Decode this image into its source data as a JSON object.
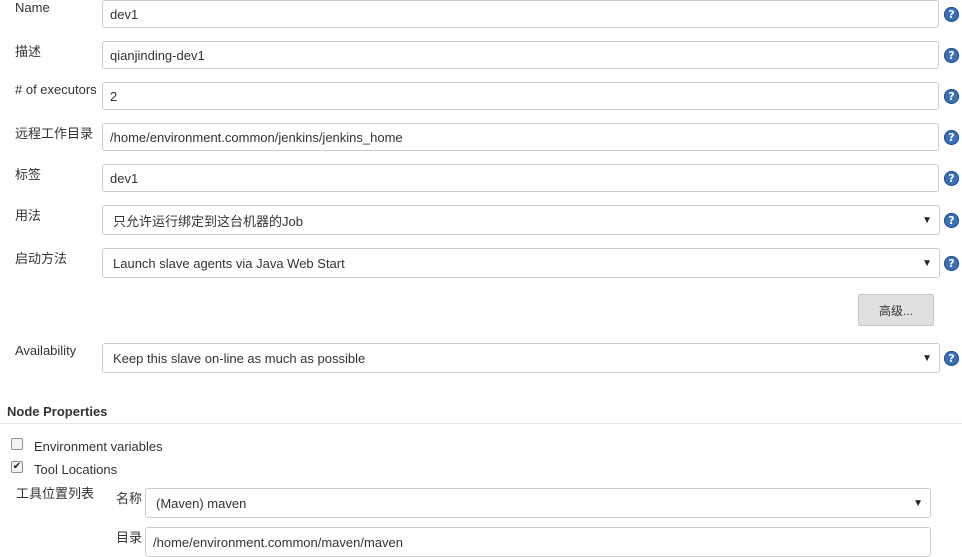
{
  "form": {
    "name": {
      "label": "Name",
      "value": "dev1"
    },
    "description": {
      "label": "描述",
      "value": "qianjinding-dev1"
    },
    "executors": {
      "label": "# of executors",
      "value": "2"
    },
    "remote_root": {
      "label": "远程工作目录",
      "value": "/home/environment.common/jenkins/jenkins_home"
    },
    "labels": {
      "label": "标签",
      "value": "dev1"
    },
    "usage": {
      "label": "用法",
      "selected": "只允许运行绑定到这台机器的Job"
    },
    "launch_method": {
      "label": "启动方法",
      "selected": "Launch slave agents via Java Web Start"
    },
    "advanced_button": "高级...",
    "availability": {
      "label": "Availability",
      "selected": "Keep this slave on-line as much as possible"
    }
  },
  "help_icon_glyph": "?",
  "dropdown_arrow_glyph": "▼",
  "node_properties": {
    "title": "Node Properties",
    "env_vars": {
      "label": "Environment variables",
      "checked": false
    },
    "tool_locations": {
      "label": "Tool Locations",
      "checked": true,
      "check_glyph": "✔"
    },
    "tool_list_label": "工具位置列表",
    "tool_name": {
      "label": "名称",
      "selected": "(Maven) maven"
    },
    "tool_home": {
      "label": "目录",
      "value": "/home/environment.common/maven/maven"
    }
  },
  "colors": {
    "help_icon": "#3d71b7",
    "button_bg": "#e0e0e0",
    "border": "#cccccc"
  }
}
